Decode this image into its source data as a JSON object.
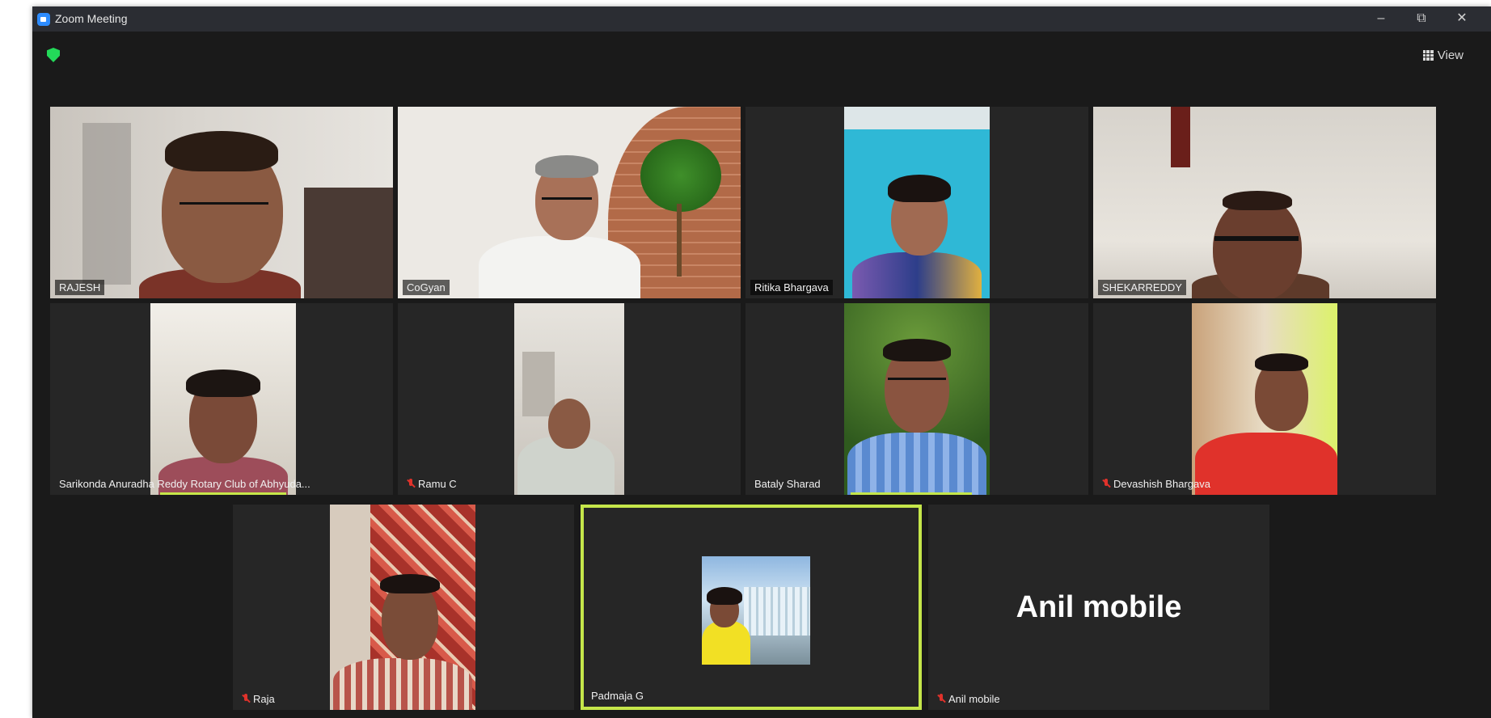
{
  "window": {
    "title": "Zoom Meeting"
  },
  "controls": {
    "minimize": "–",
    "maximize": "⧉",
    "close": "✕"
  },
  "toolbar": {
    "view_label": "View"
  },
  "icons": {
    "security": "shield-icon",
    "view": "grid-icon",
    "muted": "mic-muted-icon"
  },
  "colors": {
    "active_speaker": "#c5e64a",
    "security": "#23d959",
    "muted": "#e0322b"
  },
  "participants": [
    {
      "name": "RAJESH",
      "muted": false
    },
    {
      "name": "CoGyan",
      "muted": false
    },
    {
      "name": "Ritika Bhargava",
      "muted": false
    },
    {
      "name": "SHEKARREDDY",
      "muted": false
    },
    {
      "name": "Sarikonda Anuradha Reddy Rotary Club of Abhyuda...",
      "muted": false
    },
    {
      "name": "Ramu C",
      "muted": true
    },
    {
      "name": "Bataly Sharad",
      "muted": false
    },
    {
      "name": "Devashish Bhargava",
      "muted": true
    },
    {
      "name": "Raja",
      "muted": true
    },
    {
      "name": "Padmaja G",
      "muted": false,
      "active": true
    },
    {
      "name": "Anil mobile",
      "muted": true,
      "video": false,
      "display_name": "Anil mobile"
    }
  ]
}
